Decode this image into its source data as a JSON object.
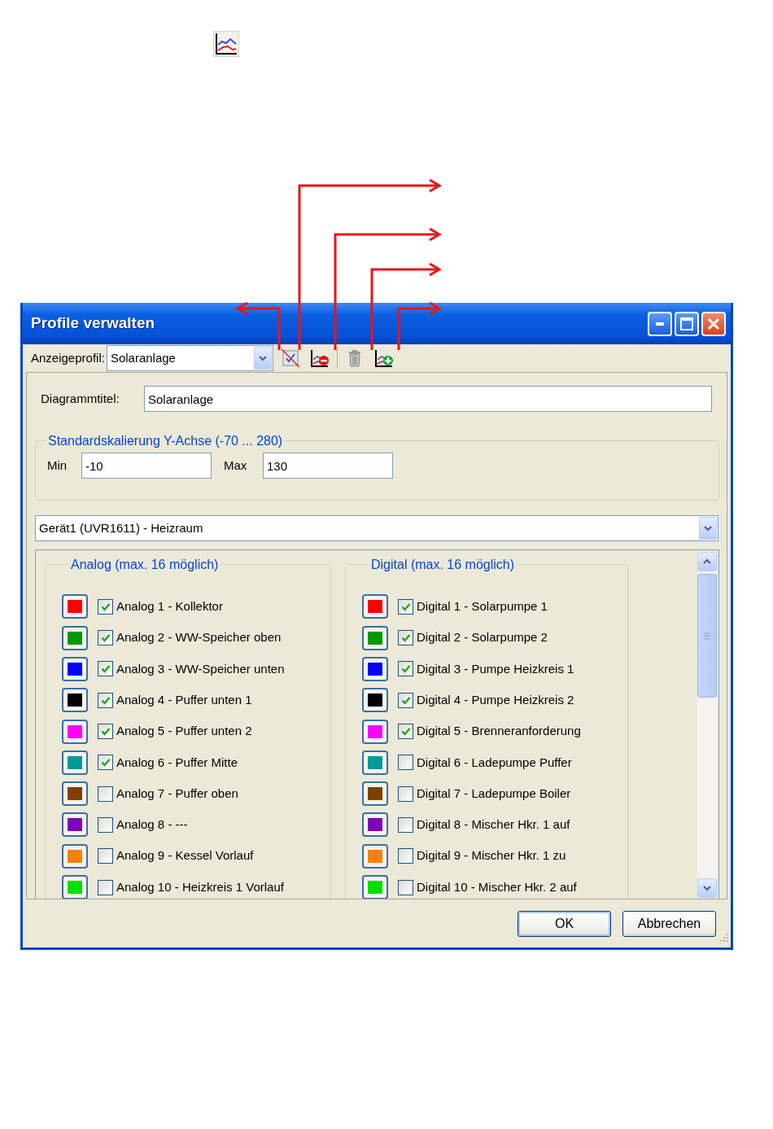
{
  "window": {
    "title": "Profile verwalten"
  },
  "toolbar": {
    "profile_label": "Anzeigeprofil:",
    "profile_value": "Solaranlage"
  },
  "diagram_title": {
    "label": "Diagrammtitel:",
    "value": "Solaranlage"
  },
  "y_scale": {
    "title": "Standardskalierung Y-Achse (-70 ... 280)",
    "min_label": "Min",
    "min_value": "-10",
    "max_label": "Max",
    "max_value": "130"
  },
  "device": {
    "value": "Gerät1 (UVR1611) - Heizraum"
  },
  "analog": {
    "title": "Analog (max. 16 möglich)",
    "items": [
      {
        "label": "Analog 1 - Kollektor",
        "checked": true,
        "color": "#ff0000"
      },
      {
        "label": "Analog 2 - WW-Speicher oben",
        "checked": true,
        "color": "#009900"
      },
      {
        "label": "Analog 3 - WW-Speicher unten",
        "checked": true,
        "color": "#0000ff"
      },
      {
        "label": "Analog 4 - Puffer unten 1",
        "checked": true,
        "color": "#000000"
      },
      {
        "label": "Analog 5 - Puffer unten 2",
        "checked": true,
        "color": "#ff00ff"
      },
      {
        "label": "Analog 6 - Puffer Mitte",
        "checked": true,
        "color": "#009999"
      },
      {
        "label": "Analog 7 - Puffer oben",
        "checked": false,
        "color": "#804000"
      },
      {
        "label": "Analog 8 - ---",
        "checked": false,
        "color": "#8000c0"
      },
      {
        "label": "Analog 9 - Kessel Vorlauf",
        "checked": false,
        "color": "#ff8000"
      },
      {
        "label": "Analog 10 - Heizkreis 1 Vorlauf",
        "checked": false,
        "color": "#00e000"
      }
    ]
  },
  "digital": {
    "title": "Digital (max. 16 möglich)",
    "items": [
      {
        "label": "Digital 1 - Solarpumpe 1",
        "checked": true,
        "color": "#ff0000"
      },
      {
        "label": "Digital 2 - Solarpumpe 2",
        "checked": true,
        "color": "#009900"
      },
      {
        "label": "Digital 3 - Pumpe Heizkreis 1",
        "checked": true,
        "color": "#0000ff"
      },
      {
        "label": "Digital 4 - Pumpe Heizkreis 2",
        "checked": true,
        "color": "#000000"
      },
      {
        "label": "Digital 5 - Brenneranforderung",
        "checked": true,
        "color": "#ff00ff"
      },
      {
        "label": "Digital 6 - Ladepumpe Puffer",
        "checked": false,
        "color": "#009999"
      },
      {
        "label": "Digital 7 - Ladepumpe Boiler",
        "checked": false,
        "color": "#804000"
      },
      {
        "label": "Digital 8 - Mischer Hkr. 1 auf",
        "checked": false,
        "color": "#8000c0"
      },
      {
        "label": "Digital 9 - Mischer Hkr. 1 zu",
        "checked": false,
        "color": "#ff8000"
      },
      {
        "label": "Digital 10 - Mischer Hkr. 2 auf",
        "checked": false,
        "color": "#00e000"
      }
    ]
  },
  "buttons": [
    "OK",
    "Abbrechen"
  ]
}
